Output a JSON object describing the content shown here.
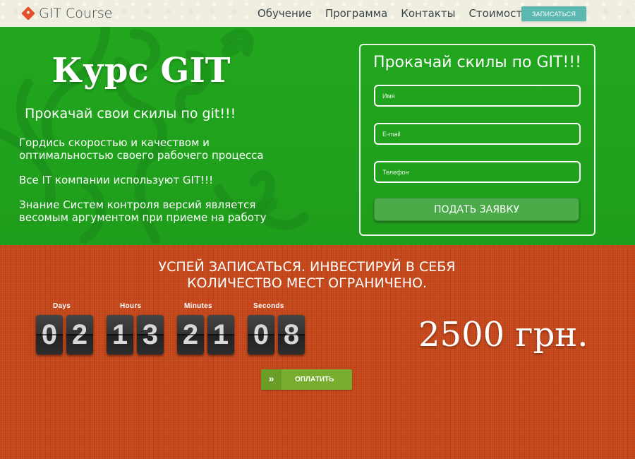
{
  "header": {
    "logo_text": "GIT Course",
    "nav": [
      "Обучение",
      "Программа",
      "Контакты",
      "Стоимость"
    ],
    "signup_label": "ЗАПИСАТЬСЯ"
  },
  "hero": {
    "title": "Курс GIT",
    "subtitle": "Прокачай свои скилы по git!!!",
    "paragraphs": [
      "Гордись скоростью и качеством и оптимальностью своего рабочего процесса",
      "Все IT компании используют GIT!!!",
      "Знание Систем контроля версий является весомым аргументом при приеме на работу"
    ]
  },
  "form": {
    "title": "Прокачай скилы по GIT!!!",
    "name_placeholder": "Имя",
    "email_placeholder": "E-mail",
    "phone_placeholder": "Телефон",
    "submit_label": "ПОДАТЬ ЗАЯВКУ"
  },
  "promo": {
    "line1": "УСПЕЙ ЗАПИСАТЬСЯ. ИНВЕСТИРУЙ В СЕБЯ",
    "line2": "КОЛИЧЕСТВО МЕСТ ОГРАНИЧЕНО.",
    "countdown": {
      "days_label": "Days",
      "hours_label": "Hours",
      "minutes_label": "Minutes",
      "seconds_label": "Seconds",
      "d1": "0",
      "d2": "2",
      "h1": "1",
      "h2": "3",
      "m1": "2",
      "m2": "1",
      "s1": "0",
      "s2": "8"
    },
    "price": "2500 грн.",
    "pay_label": "ОПЛАТИТЬ"
  },
  "colors": {
    "hero_green": "#22a71e",
    "promo_orange": "#c8481a",
    "signup_teal": "#5bb8b0",
    "pay_green": "#78ad2f",
    "logo_red": "#e4502c"
  },
  "icons": {
    "logo": "git-logo-icon",
    "pay": "double-chevron-right-icon"
  }
}
